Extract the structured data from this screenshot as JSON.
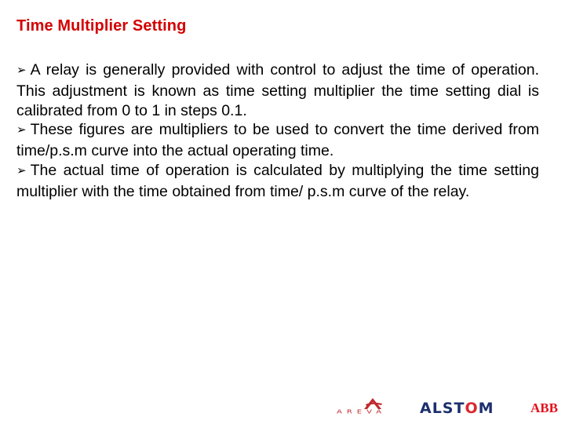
{
  "slide": {
    "title": "Time Multiplier Setting",
    "bullet_glyph": "➢",
    "bullet_icon": "arrowhead-bullet-icon",
    "paragraphs": [
      {
        "text": "A relay is generally provided with control to adjust the time of operation. This adjustment is known as time setting multiplier the time setting dial is calibrated from 0 to 1 in steps 0.1."
      },
      {
        "text": "These figures are multipliers to be used to convert the time derived from time/p.s.m curve into the actual operating time."
      },
      {
        "text": "The actual time of operation is calculated by multiplying the time setting multiplier with the time obtained from time/ p.s.m curve of the relay."
      }
    ]
  },
  "footer": {
    "logos": {
      "areva": "AREVA",
      "alstom_prefix": "ALST",
      "alstom_o": "O",
      "alstom_suffix": "M",
      "abb": "ABB"
    }
  },
  "colors": {
    "title": "#d40000",
    "text": "#000000",
    "areva": "#c0282d",
    "alstom": "#1c2f6e",
    "alstom_accent": "#d8282e",
    "abb": "#e2101c"
  }
}
